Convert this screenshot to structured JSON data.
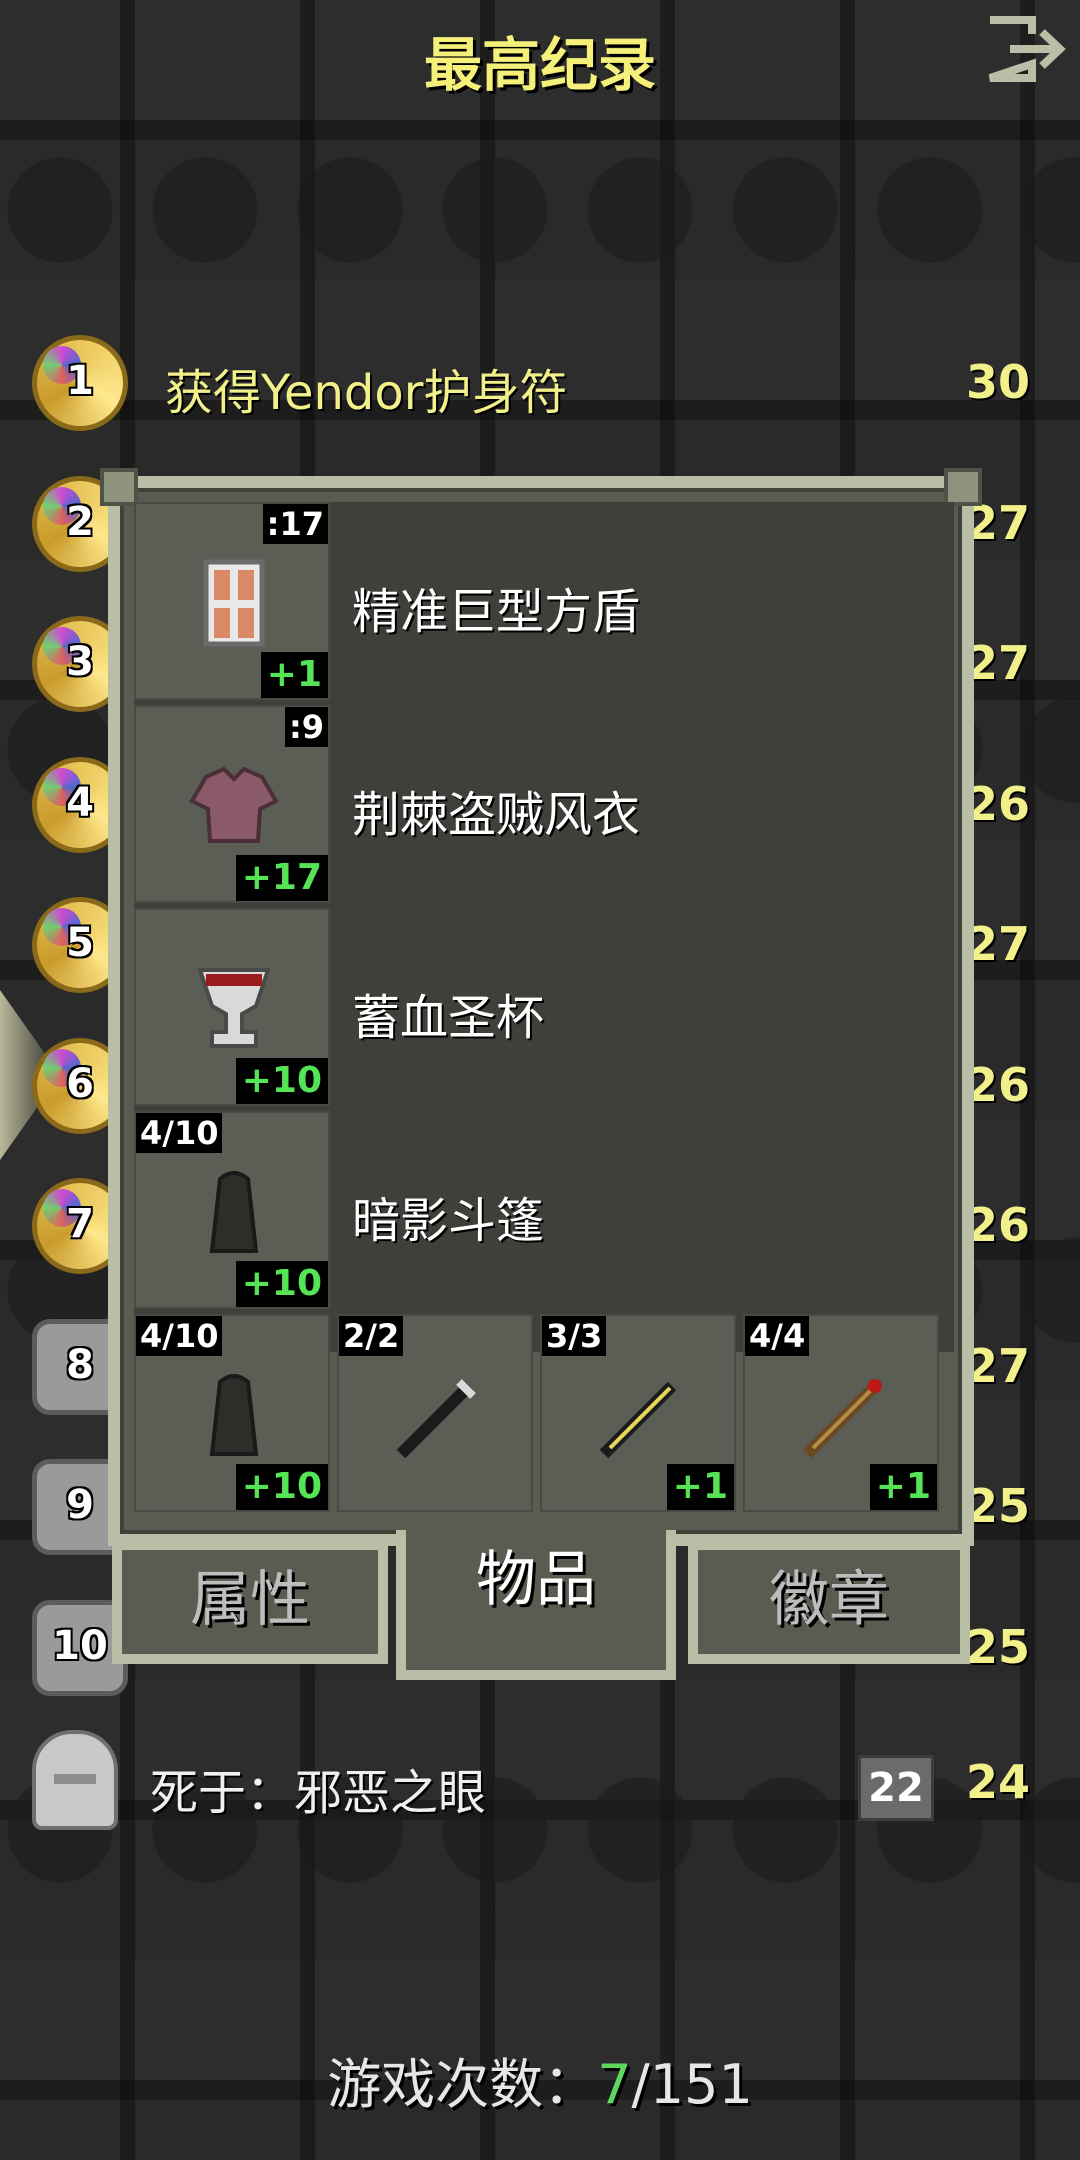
{
  "header": {
    "title": "最高纪录",
    "exit_icon": "exit-icon"
  },
  "records": [
    {
      "rank": "1",
      "text": "获得Yendor护身符",
      "score": "30",
      "medal": "gold"
    },
    {
      "rank": "2",
      "text": "",
      "score": "27",
      "medal": "gold"
    },
    {
      "rank": "3",
      "text": "",
      "score": "27",
      "medal": "gold"
    },
    {
      "rank": "4",
      "text": "",
      "score": "26",
      "medal": "gold"
    },
    {
      "rank": "5",
      "text": "",
      "score": "27",
      "medal": "gold"
    },
    {
      "rank": "6",
      "text": "",
      "score": "26",
      "medal": "gold"
    },
    {
      "rank": "7",
      "text": "",
      "score": "26",
      "medal": "gold"
    },
    {
      "rank": "8",
      "text": "",
      "score": "27",
      "medal": "grey"
    },
    {
      "rank": "9",
      "text": "",
      "score": "25",
      "medal": "grey"
    },
    {
      "rank": "10",
      "text": "",
      "score": "25",
      "medal": "grey"
    }
  ],
  "death_row": {
    "text": "死于：邪恶之眼",
    "depth": "22",
    "score": "24"
  },
  "items_panel": {
    "items": [
      {
        "name": "精准巨型方盾",
        "top_right": ":17",
        "bonus": "+1",
        "icon": "tower-shield-icon"
      },
      {
        "name": "荆棘盗贼风衣",
        "top_right": ":9",
        "bonus": "+17",
        "icon": "rogue-cloak-icon"
      },
      {
        "name": "蓄血圣杯",
        "top_right": "",
        "bonus": "+10",
        "icon": "chalice-icon"
      },
      {
        "name": "暗影斗篷",
        "top_left": "4/10",
        "bonus": "+10",
        "icon": "shadow-cloak-icon"
      }
    ],
    "quickslots": [
      {
        "top_left": "4/10",
        "bonus": "+10",
        "icon": "shadow-cloak-icon"
      },
      {
        "top_left": "2/2",
        "bonus": "",
        "icon": "wand-dark-icon"
      },
      {
        "top_left": "3/3",
        "bonus": "+1",
        "icon": "wand-yellow-icon"
      },
      {
        "top_left": "4/4",
        "bonus": "+1",
        "icon": "wand-wood-icon"
      }
    ]
  },
  "tabs": [
    {
      "label": "属性",
      "active": false
    },
    {
      "label": "物品",
      "active": true
    },
    {
      "label": "徽章",
      "active": false
    }
  ],
  "footer": {
    "prefix": "游戏次数：",
    "current": "7",
    "total": "/151"
  }
}
